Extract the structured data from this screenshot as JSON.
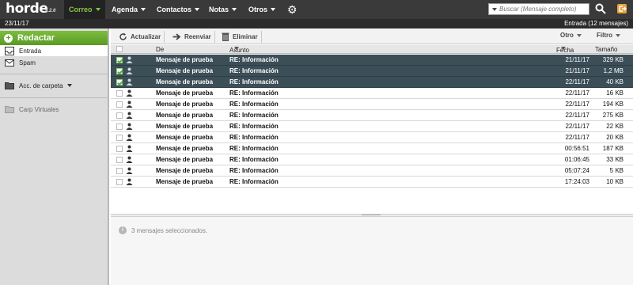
{
  "brand": {
    "logo": "horde",
    "version": "5.2.6"
  },
  "nav": [
    {
      "label": "Correo"
    },
    {
      "label": "Agenda"
    },
    {
      "label": "Contactos"
    },
    {
      "label": "Notas"
    },
    {
      "label": "Otros"
    }
  ],
  "search": {
    "placeholder": "Buscar (Mensaje completo)"
  },
  "datebar": {
    "date": "23/11/17",
    "folder_info": "Entrada (12 mensajes)"
  },
  "sidebar": {
    "compose_label": "Redactar",
    "items": [
      {
        "label": "Entrada"
      },
      {
        "label": "Spam"
      },
      {
        "label": "Acc. de carpeta"
      },
      {
        "label": "Carp Virtuales"
      }
    ]
  },
  "toolbar": {
    "refresh_label": "Actualizar",
    "forward_label": "Reenviar",
    "delete_label": "Eliminar",
    "other_label": "Otro",
    "filter_label": "Filtro"
  },
  "table": {
    "headers": {
      "from": "De",
      "subject": "Asunto",
      "date": "Fecha",
      "size": "Tamaño"
    },
    "rows": [
      {
        "from": "Mensaje de prueba",
        "subject": "RE: Información",
        "date": "21/11/17",
        "size": "329 KB",
        "selected": true
      },
      {
        "from": "Mensaje de prueba",
        "subject": "RE: Información",
        "date": "21/11/17",
        "size": "1,2 MB",
        "selected": true
      },
      {
        "from": "Mensaje de prueba",
        "subject": "RE: Información",
        "date": "22/11/17",
        "size": "40 KB",
        "selected": true
      },
      {
        "from": "Mensaje de prueba",
        "subject": "RE: Información",
        "date": "22/11/17",
        "size": "16 KB",
        "selected": false
      },
      {
        "from": "Mensaje de prueba",
        "subject": "RE: Información",
        "date": "22/11/17",
        "size": "194 KB",
        "selected": false
      },
      {
        "from": "Mensaje de prueba",
        "subject": "RE: Información",
        "date": "22/11/17",
        "size": "275 KB",
        "selected": false
      },
      {
        "from": "Mensaje de prueba",
        "subject": "RE: Información",
        "date": "22/11/17",
        "size": "22 KB",
        "selected": false
      },
      {
        "from": "Mensaje de prueba",
        "subject": "RE: Información",
        "date": "22/11/17",
        "size": "20 KB",
        "selected": false
      },
      {
        "from": "Mensaje de prueba",
        "subject": "RE: Información",
        "date": "00:56:51",
        "size": "187 KB",
        "selected": false
      },
      {
        "from": "Mensaje de prueba",
        "subject": "RE: Información",
        "date": "01:06:45",
        "size": "33 KB",
        "selected": false
      },
      {
        "from": "Mensaje de prueba",
        "subject": "RE: Información",
        "date": "05:07:24",
        "size": "5 KB",
        "selected": false
      },
      {
        "from": "Mensaje de prueba",
        "subject": "RE: Información",
        "date": "17:24:03",
        "size": "10 KB",
        "selected": false
      }
    ]
  },
  "preview": {
    "status": "3 mensajes seleccionados."
  },
  "colors": {
    "accent": "#8bc34a",
    "selected_row": "#3c4e57",
    "topbar": "#3a3a3a"
  }
}
